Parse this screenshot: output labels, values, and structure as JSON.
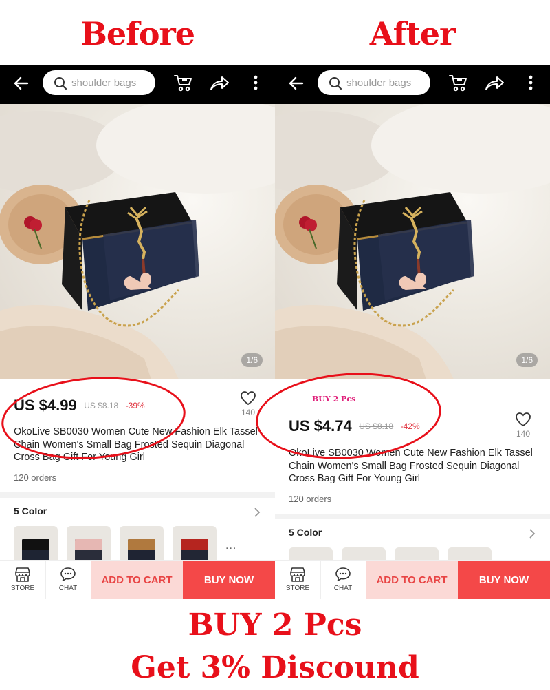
{
  "headings": {
    "before": "Before",
    "after": "After"
  },
  "search": {
    "placeholder": "shoulder bags"
  },
  "image_counter": "1/6",
  "before": {
    "price": "US $4.99",
    "old_price": "US $8.18",
    "discount": "-39%",
    "wishlist_count": "140",
    "title": "OkoLive SB0030 Women Cute New Fashion Elk Tassel Chain Women's Small Bag Frosted Sequin Diagonal Cross Bag Gift For Young Girl",
    "orders": "120 orders",
    "color_label": "5 Color"
  },
  "after": {
    "promo_note": "BUY 2 Pcs",
    "price": "US $4.74",
    "old_price": "US $8.18",
    "discount": "-42%",
    "wishlist_count": "140",
    "title": "OkoLive SB0030 Women Cute New Fashion Elk Tassel Chain Women's Small Bag Frosted Sequin Diagonal Cross Bag Gift For Young Girl",
    "orders": "120 orders",
    "color_label": "5 Color"
  },
  "bottom_bar": {
    "store_label": "STORE",
    "chat_label": "CHAT",
    "add_to_cart_label": "ADD TO CART",
    "buy_now_label": "BUY NOW"
  },
  "thumbnails": [
    "black",
    "pink",
    "brown",
    "red"
  ],
  "more_colors": "...",
  "promo_banner": {
    "line1": "BUY 2 Pcs",
    "line2": "Get 3% Discound"
  },
  "colors": {
    "accent_red": "#e8101a",
    "buy_now_bg": "#f44848",
    "add_to_cart_bg": "#fbd9d6",
    "discount_text": "#e0303c",
    "topbar_bg": "#000000"
  },
  "icons": [
    "back-arrow-icon",
    "search-icon",
    "cart-icon",
    "share-icon",
    "more-vertical-icon",
    "heart-icon",
    "chevron-right-icon",
    "store-icon",
    "chat-icon"
  ]
}
